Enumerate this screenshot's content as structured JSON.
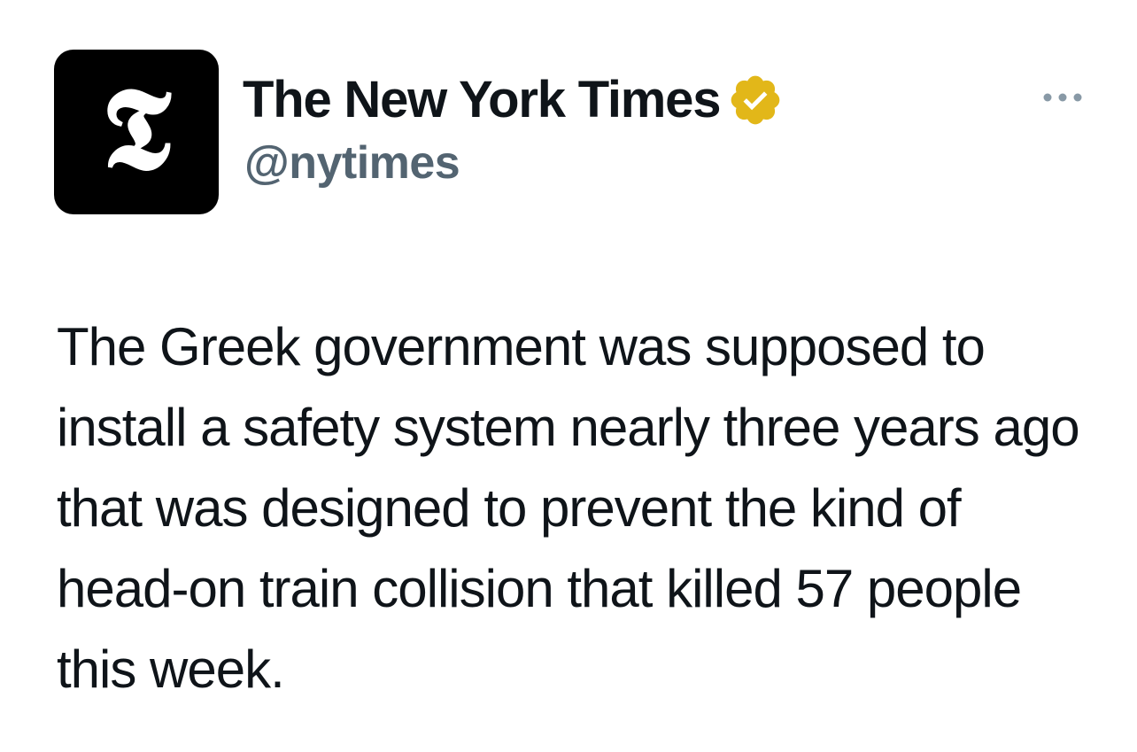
{
  "tweet": {
    "author": {
      "name": "The New York Times",
      "handle": "@nytimes",
      "avatar_glyph": "𝕿",
      "avatar_icon": "nyt-t-logo-icon",
      "verified": true,
      "verified_icon": "verified-badge-icon",
      "verified_color": "#e2b719"
    },
    "more_icon": "more-options-icon",
    "text": "The Greek government was supposed to install a safety system nearly three years ago that was designed to prevent the kind of head-on train collision that killed 57 people this week."
  },
  "colors": {
    "background": "#ffffff",
    "text_primary": "#0f1419",
    "text_secondary": "#536471",
    "avatar_bg": "#000000",
    "more_dots": "#8899a6"
  }
}
